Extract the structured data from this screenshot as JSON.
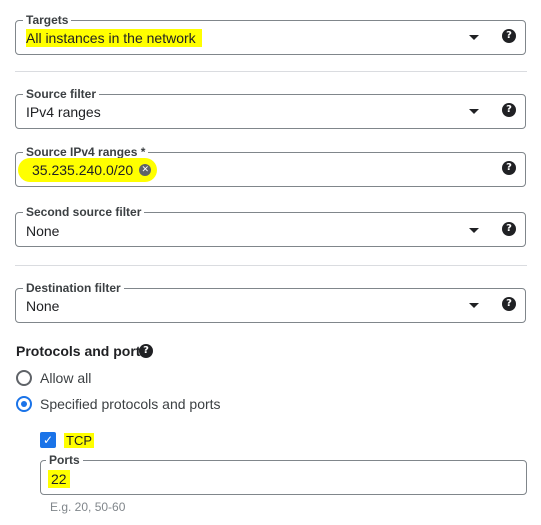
{
  "targets": {
    "label": "Targets",
    "value": "All instances in the network",
    "help_icon": "help-icon",
    "dropdown_icon": "dropdown-arrow-icon"
  },
  "source_filter": {
    "label": "Source filter",
    "value": "IPv4 ranges"
  },
  "source_ranges": {
    "label": "Source IPv4 ranges *",
    "chips": [
      "35.235.240.0/20"
    ]
  },
  "second_source_filter": {
    "label": "Second source filter",
    "value": "None"
  },
  "destination_filter": {
    "label": "Destination filter",
    "value": "None"
  },
  "protocols": {
    "title": "Protocols and ports",
    "options": [
      "Allow all",
      "Specified protocols and ports"
    ],
    "selected": "Specified protocols and ports",
    "tcp": {
      "label": "TCP",
      "checked": true,
      "ports_label": "Ports",
      "ports_value": "22",
      "hint": "E.g. 20, 50-60"
    }
  },
  "colors": {
    "highlight": "#ffff00",
    "accent": "#1a73e8",
    "border": "#80868b",
    "text": "#202124"
  }
}
